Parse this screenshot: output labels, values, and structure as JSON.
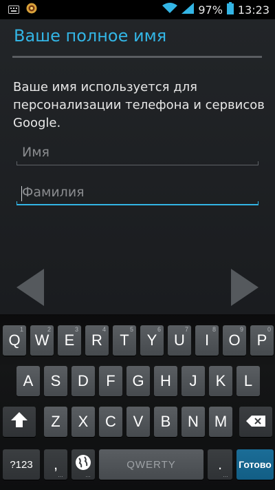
{
  "status_bar": {
    "battery": "97%",
    "time": "13:23"
  },
  "page": {
    "title": "Ваше полное имя",
    "description": "Ваше имя используется для персонализации телефона и сервисов Google.",
    "first_name_placeholder": "Имя",
    "last_name_placeholder": "Фамилия"
  },
  "keyboard": {
    "row1": [
      {
        "label": "Q",
        "hint": "1"
      },
      {
        "label": "W",
        "hint": "2"
      },
      {
        "label": "E",
        "hint": "3"
      },
      {
        "label": "R",
        "hint": "4"
      },
      {
        "label": "T",
        "hint": "5"
      },
      {
        "label": "Y",
        "hint": "6"
      },
      {
        "label": "U",
        "hint": "7"
      },
      {
        "label": "I",
        "hint": "8"
      },
      {
        "label": "O",
        "hint": "9"
      },
      {
        "label": "P",
        "hint": "0"
      }
    ],
    "row2": [
      "A",
      "S",
      "D",
      "F",
      "G",
      "H",
      "J",
      "K",
      "L"
    ],
    "row3": [
      "Z",
      "X",
      "C",
      "V",
      "B",
      "N",
      "M"
    ],
    "symbols_label": "?123",
    "comma_label": ",",
    "space_label": "QWERTY",
    "period_label": ".",
    "done_label": "Готово"
  },
  "colors": {
    "accent": "#33b5e5",
    "background": "#1b1d20",
    "key": "#505458",
    "done_key": "#176892"
  }
}
